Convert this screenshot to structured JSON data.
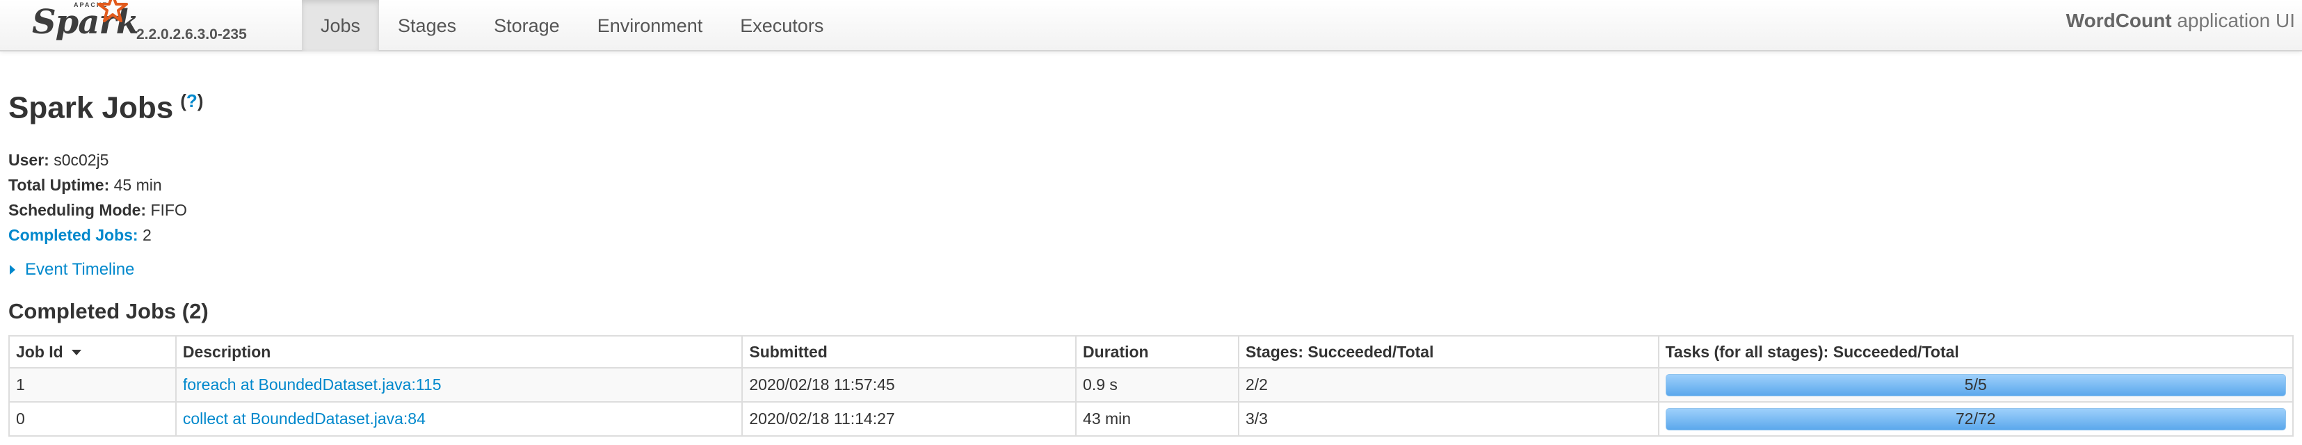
{
  "navbar": {
    "logo_apache": "APACHE",
    "logo_spark": "Spark",
    "version": "2.2.0.2.6.3.0-235",
    "tabs": [
      {
        "label": "Jobs",
        "active": true
      },
      {
        "label": "Stages",
        "active": false
      },
      {
        "label": "Storage",
        "active": false
      },
      {
        "label": "Environment",
        "active": false
      },
      {
        "label": "Executors",
        "active": false
      }
    ],
    "app_name": "WordCount",
    "app_suffix": " application UI"
  },
  "page": {
    "title": "Spark Jobs",
    "help_text": "(?)",
    "help_link": "?"
  },
  "summary": {
    "user_label": "User:",
    "user_value": " s0c02j5",
    "uptime_label": "Total Uptime:",
    "uptime_value": " 45 min",
    "scheduling_label": "Scheduling Mode:",
    "scheduling_value": " FIFO",
    "completed_label": "Completed Jobs:",
    "completed_value": " 2"
  },
  "event_timeline": "Event Timeline",
  "completed_section": {
    "title": "Completed Jobs (2)",
    "columns": [
      "Job Id",
      "Description",
      "Submitted",
      "Duration",
      "Stages: Succeeded/Total",
      "Tasks (for all stages): Succeeded/Total"
    ],
    "rows": [
      {
        "job_id": "1",
        "description": "foreach at BoundedDataset.java:115",
        "submitted": "2020/02/18 11:57:45",
        "duration": "0.9 s",
        "stages": "2/2",
        "tasks": "5/5",
        "progress": 1.0
      },
      {
        "job_id": "0",
        "description": "collect at BoundedDataset.java:84",
        "submitted": "2020/02/18 11:14:27",
        "duration": "43 min",
        "stages": "3/3",
        "tasks": "72/72",
        "progress": 1.0
      }
    ]
  },
  "colors": {
    "link": "#0088cc",
    "progress": "#5ba8ec",
    "logo_star": "#e25a1c"
  },
  "icons": {
    "sort": "sort-descending-icon",
    "expand": "caret-right-icon",
    "logo": "spark-star-icon"
  }
}
